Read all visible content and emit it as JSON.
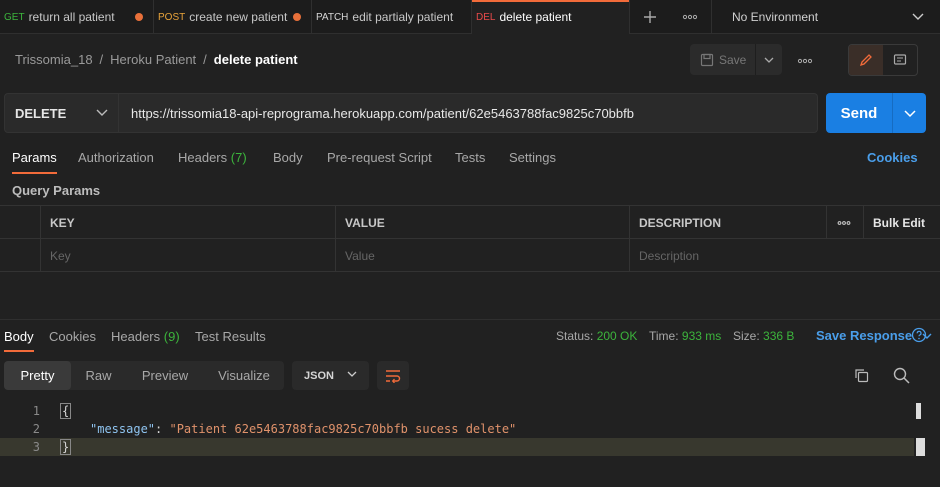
{
  "tabs": [
    {
      "method": "GET",
      "method_color": "#3cb43c",
      "title": "return all patient",
      "unsaved": true
    },
    {
      "method": "POST",
      "method_color": "#e8a33a",
      "title": "create new patient",
      "unsaved": true
    },
    {
      "method": "PATCH",
      "method_color": "#d6d6d6",
      "title": "edit partialy patient",
      "unsaved": false
    },
    {
      "method": "DEL",
      "method_color": "#e84a4a",
      "title": "delete patient",
      "unsaved": false,
      "active": true
    }
  ],
  "environment": "No Environment",
  "breadcrumb": {
    "workspace": "Trissomia_18",
    "collection": "Heroku Patient",
    "request": "delete patient",
    "sep": "/"
  },
  "toolbar": {
    "save_label": "Save"
  },
  "request": {
    "method": "DELETE",
    "url": "https://trissomia18-api-reprograma.herokuapp.com/patient/62e5463788fac9825c70bbfb",
    "send_label": "Send"
  },
  "request_tabs": {
    "params": "Params",
    "authorization": "Authorization",
    "headers": "Headers",
    "headers_count": "(7)",
    "body": "Body",
    "prerequest": "Pre-request Script",
    "tests": "Tests",
    "settings": "Settings",
    "cookies": "Cookies"
  },
  "query_params": {
    "title": "Query Params",
    "headers": {
      "key": "KEY",
      "value": "VALUE",
      "description": "DESCRIPTION",
      "bulk": "Bulk Edit"
    },
    "placeholders": {
      "key": "Key",
      "value": "Value",
      "description": "Description"
    }
  },
  "response_tabs": {
    "body": "Body",
    "cookies": "Cookies",
    "headers": "Headers",
    "headers_count": "(9)",
    "test_results": "Test Results"
  },
  "status": {
    "status_label": "Status:",
    "status_value": "200 OK",
    "time_label": "Time:",
    "time_value": "933 ms",
    "size_label": "Size:",
    "size_value": "336 B",
    "save_response": "Save Response"
  },
  "view": {
    "pretty": "Pretty",
    "raw": "Raw",
    "preview": "Preview",
    "visualize": "Visualize",
    "format": "JSON"
  },
  "code": {
    "line_numbers": [
      "1",
      "2",
      "3"
    ],
    "open_brace": "{",
    "close_brace": "}",
    "key": "\"message\"",
    "colon": ": ",
    "value": "\"Patient 62e5463788fac9825c70bbfb sucess delete\""
  }
}
